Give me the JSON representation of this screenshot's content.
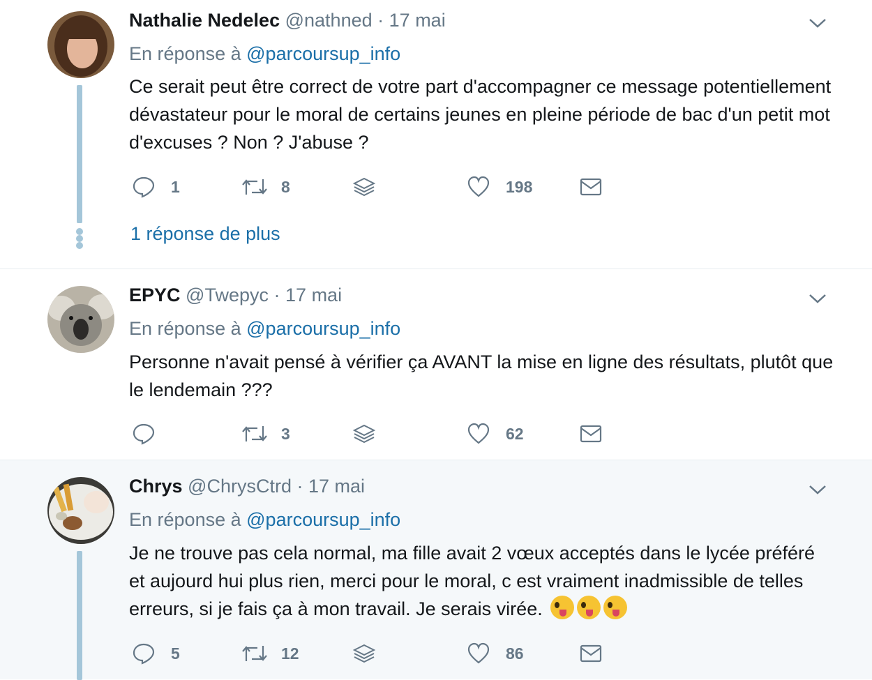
{
  "tweets": [
    {
      "name": "Nathalie Nedelec",
      "handle": "@nathned",
      "separator": "·",
      "date": "17 mai",
      "reply_prefix": "En réponse à",
      "reply_to": "@parcoursup_info",
      "text": "Ce serait peut être correct de votre part d'accompagner ce message potentiellement dévastateur pour le moral de certains jeunes en pleine période de bac d'un petit mot d'excuses ? Non ? J'abuse ?",
      "replies": "1",
      "retweets": "8",
      "likes": "198",
      "more_replies": "1 réponse de plus"
    },
    {
      "name": "EPYC",
      "handle": "@Twepyc",
      "separator": "·",
      "date": "17 mai",
      "reply_prefix": "En réponse à",
      "reply_to": "@parcoursup_info",
      "text": "Personne n'avait pensé à vérifier ça AVANT la mise en ligne des résultats, plutôt que le lendemain ???",
      "replies": "",
      "retweets": "3",
      "likes": "62"
    },
    {
      "name": "Chrys",
      "handle": "@ChrysCtrd",
      "separator": "·",
      "date": "17 mai",
      "reply_prefix": "En réponse à",
      "reply_to": "@parcoursup_info",
      "text": "Je ne trouve pas cela normal, ma fille avait 2 vœux acceptés dans le lycée préféré et aujourd hui plus rien, merci pour le moral, c est vraiment inadmissible de telles erreurs, si je fais ça à mon travail. Je serais virée.",
      "replies": "5",
      "retweets": "12",
      "likes": "86"
    }
  ],
  "icons": {
    "reply": "speech-bubble-icon",
    "retweet": "retweet-arrows-icon",
    "stack": "layers-icon",
    "like": "heart-icon",
    "dm": "envelope-icon",
    "menu": "chevron-down-icon",
    "emoji": "zany-face-emoji"
  },
  "colors": {
    "link": "#1b6fa8",
    "muted": "#657786",
    "thread": "#a4c6d9",
    "highlight_bg": "#f5f8fa"
  }
}
